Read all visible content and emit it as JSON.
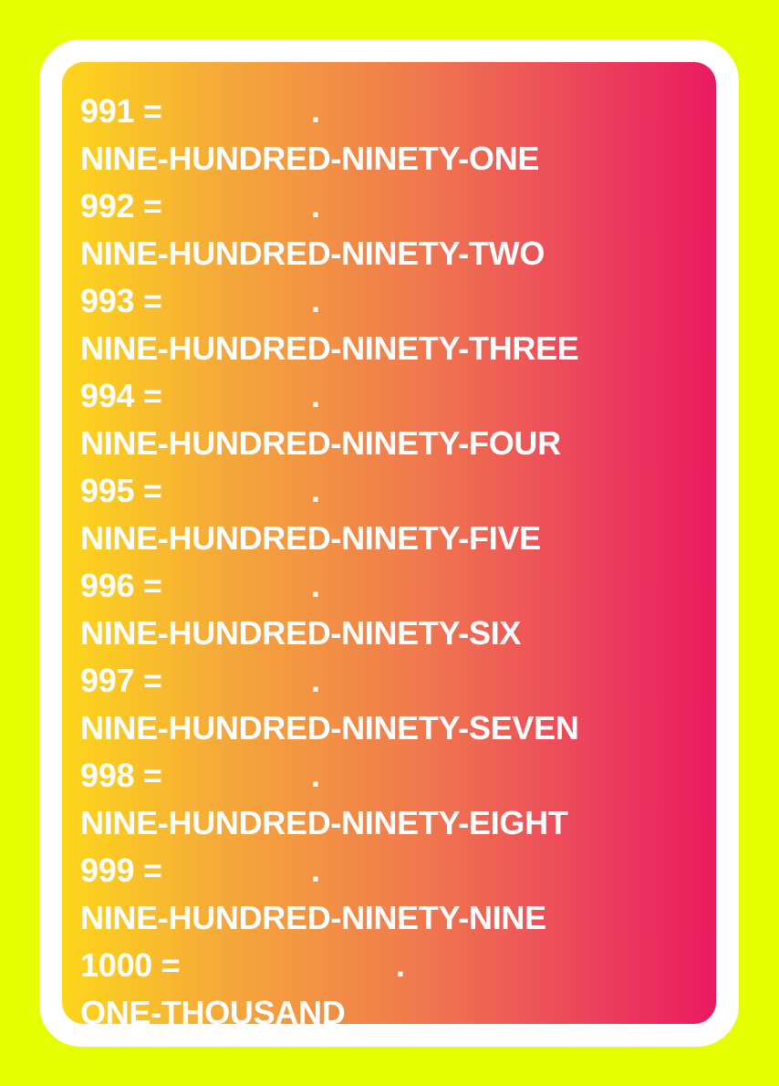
{
  "entries": [
    {
      "equation": "991 =",
      "dot": ".",
      "words": "NINE-HUNDRED-NINETY-ONE"
    },
    {
      "equation": "992 =",
      "dot": ".",
      "words": "NINE-HUNDRED-NINETY-TWO"
    },
    {
      "equation": "993 =",
      "dot": ".",
      "words": "NINE-HUNDRED-NINETY-THREE"
    },
    {
      "equation": "994 =",
      "dot": ".",
      "words": "NINE-HUNDRED-NINETY-FOUR"
    },
    {
      "equation": "995 =",
      "dot": ".",
      "words": "NINE-HUNDRED-NINETY-FIVE"
    },
    {
      "equation": "996 =",
      "dot": ".",
      "words": "NINE-HUNDRED-NINETY-SIX"
    },
    {
      "equation": "997 =",
      "dot": ".",
      "words": "NINE-HUNDRED-NINETY-SEVEN"
    },
    {
      "equation": "998 =",
      "dot": ".",
      "words": "NINE-HUNDRED-NINETY-EIGHT"
    },
    {
      "equation": "999 =",
      "dot": ".",
      "words": "NINE-HUNDRED-NINETY-NINE"
    },
    {
      "equation": "1000 =",
      "dot": ".",
      "words": "ONE-THOUSAND"
    }
  ],
  "colors": {
    "background": "#e6ff00",
    "frame": "#ffffff",
    "gradient_start": "#fdd61b",
    "gradient_end": "#e91a60",
    "text": "#ffffff"
  }
}
